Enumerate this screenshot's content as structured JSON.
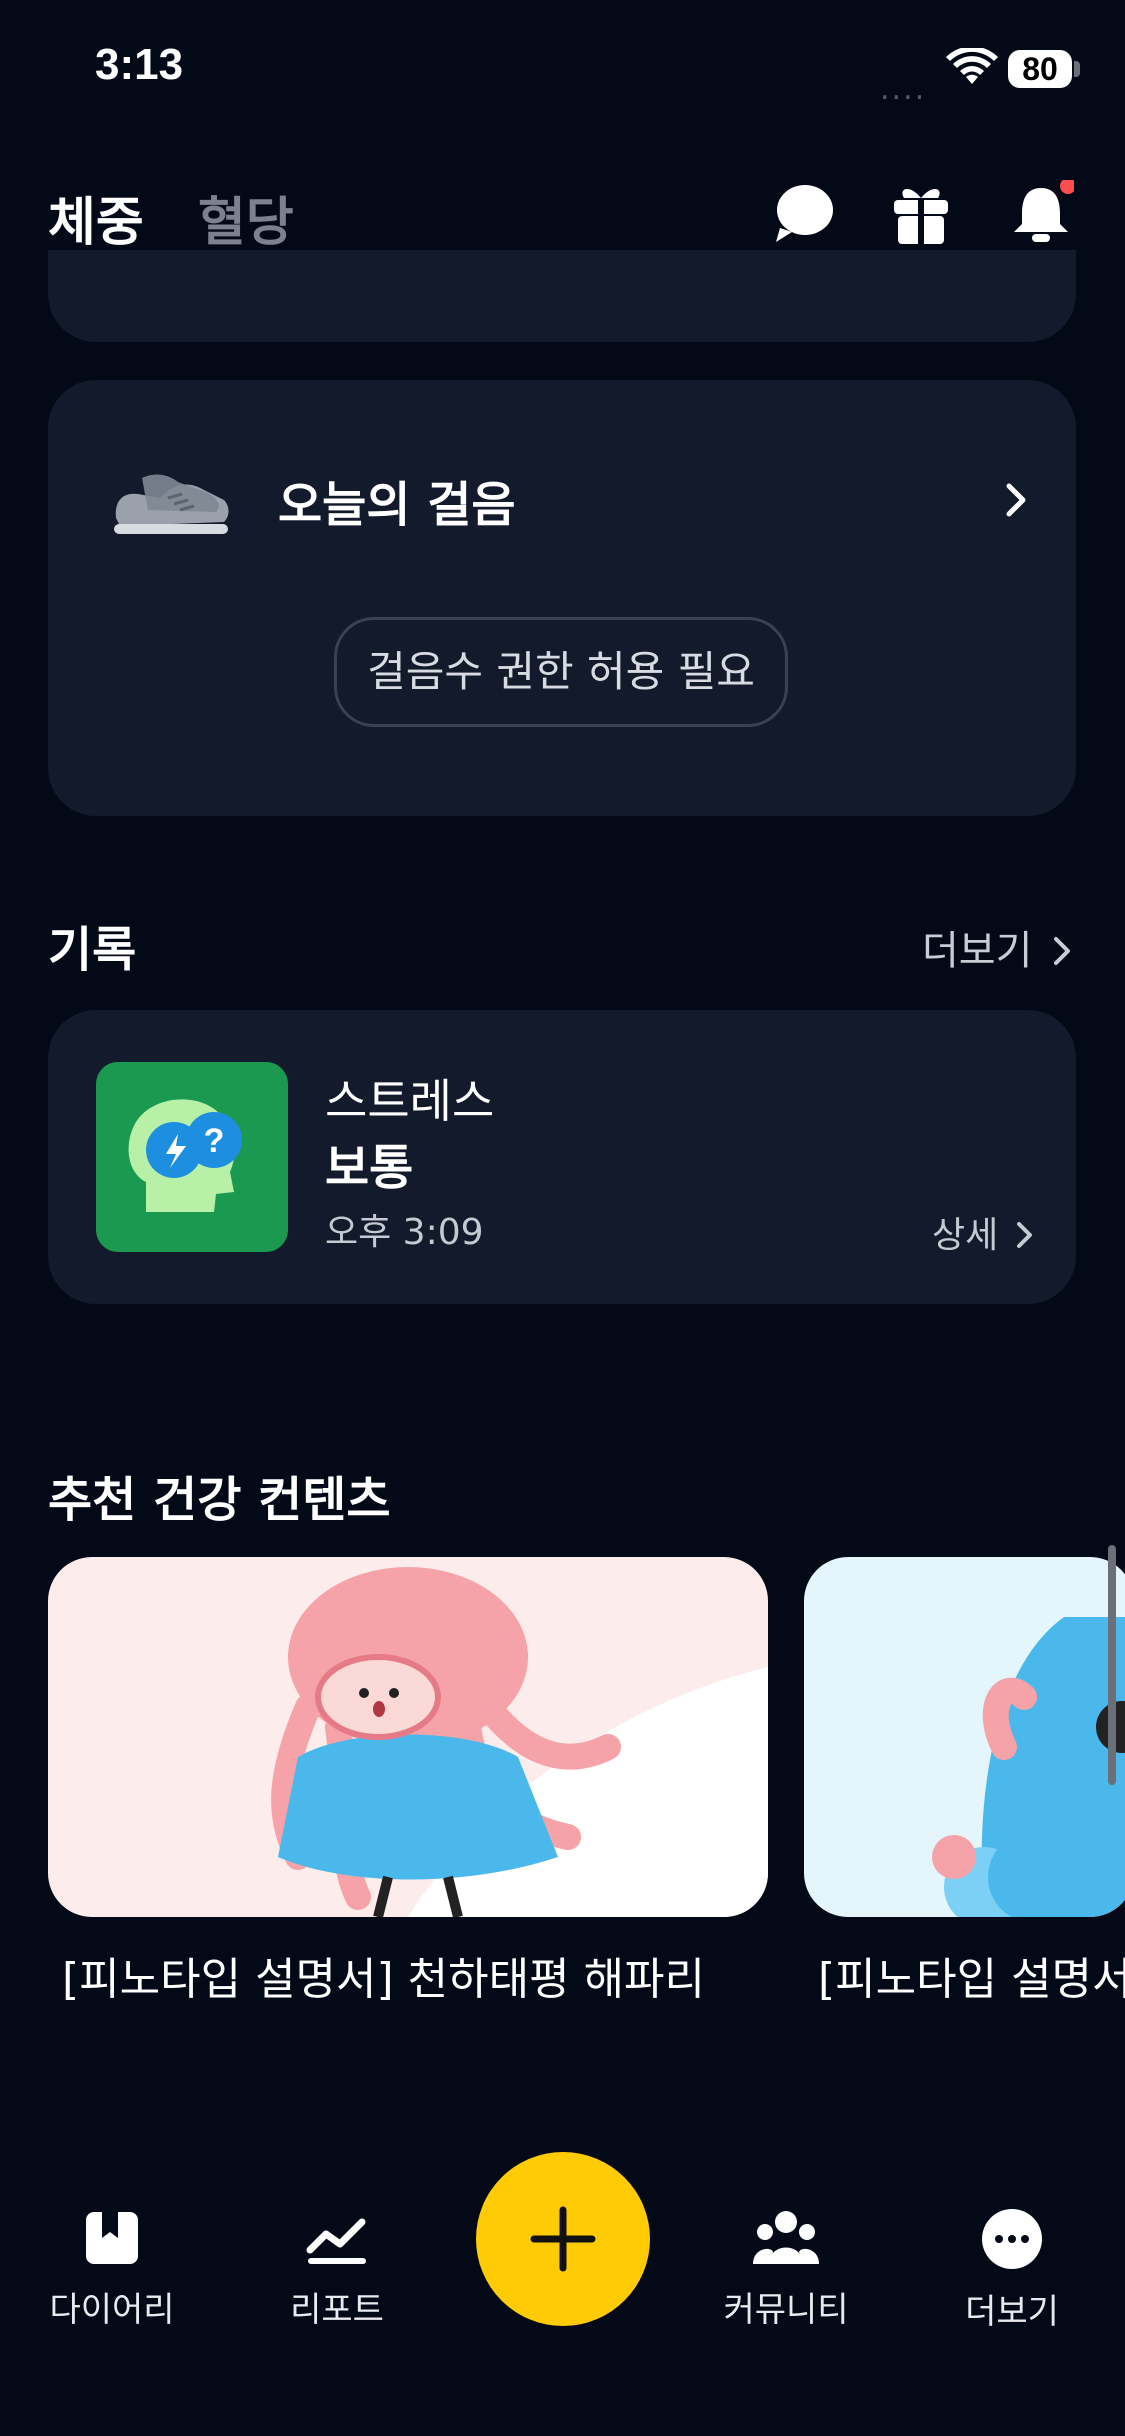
{
  "status": {
    "time": "3:13",
    "signal": "....",
    "battery": "80"
  },
  "header": {
    "tabs": [
      {
        "label": "체중"
      },
      {
        "label": "혈당"
      }
    ],
    "icons": [
      "chat-icon",
      "gift-icon",
      "bell-icon"
    ],
    "bell_badge_color": "#ff4d4f"
  },
  "walk": {
    "title": "오늘의 걸음",
    "permission_button": "걸음수 권한 허용 필요"
  },
  "records": {
    "title": "기록",
    "more_label": "더보기",
    "item": {
      "label": "스트레스",
      "value": "보통",
      "time": "오후 3:09",
      "detail_label": "상세"
    }
  },
  "recommended": {
    "title": "추천 건강 컨텐츠",
    "items": [
      {
        "caption": "[피노타입 설명서] 천하태평 해파리"
      },
      {
        "caption": "[피노타입 설명서]"
      }
    ]
  },
  "nav": {
    "items": [
      {
        "label": "다이어리"
      },
      {
        "label": "리포트"
      },
      {
        "label": "커뮤니티"
      },
      {
        "label": "더보기"
      }
    ],
    "fab_color": "#ffcb05"
  },
  "colors": {
    "background": "#030917",
    "card": "#121a2b",
    "accent": "#ffcb05"
  }
}
